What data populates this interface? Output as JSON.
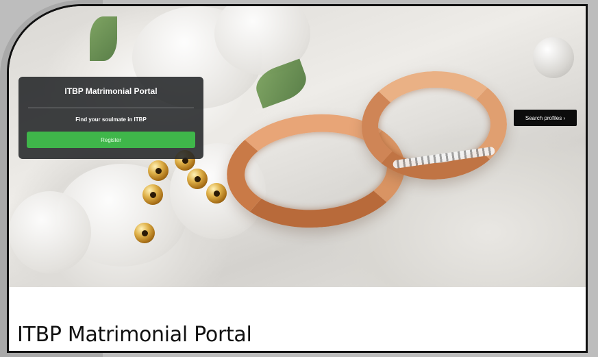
{
  "hero": {
    "card": {
      "title": "ITBP Matrimonial Portal",
      "tagline": "Find your soulmate in ITBP",
      "button_label": "Register"
    },
    "search_button_label": "Search profiles ›"
  },
  "page": {
    "title": "ITBP Matrimonial Portal"
  },
  "colors": {
    "card_bg": "#202224",
    "button_green": "#3fb64a",
    "search_bg": "#0c0c0c",
    "ring_gold": "#d48c5c"
  }
}
